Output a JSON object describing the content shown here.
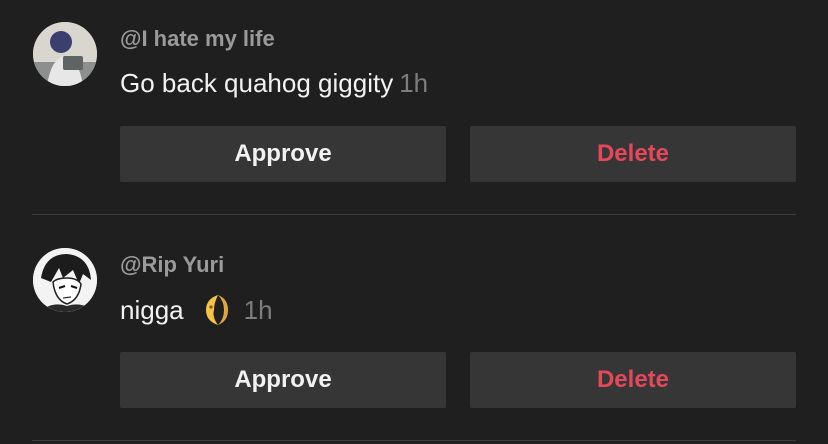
{
  "comments": [
    {
      "username": "@I hate my life",
      "text": "Go back quahog giggity",
      "time": "1h",
      "approve_label": "Approve",
      "delete_label": "Delete"
    },
    {
      "username": "@Rip Yuri",
      "text": "nigga",
      "emoji": "crescent-moon-face-emoji",
      "time": "1h",
      "approve_label": "Approve",
      "delete_label": "Delete"
    }
  ],
  "colors": {
    "background": "#1f1f1f",
    "button_bg": "#363636",
    "delete_text": "#e5475b",
    "username_text": "#9a9a9a",
    "time_text": "#7d7d7d"
  }
}
